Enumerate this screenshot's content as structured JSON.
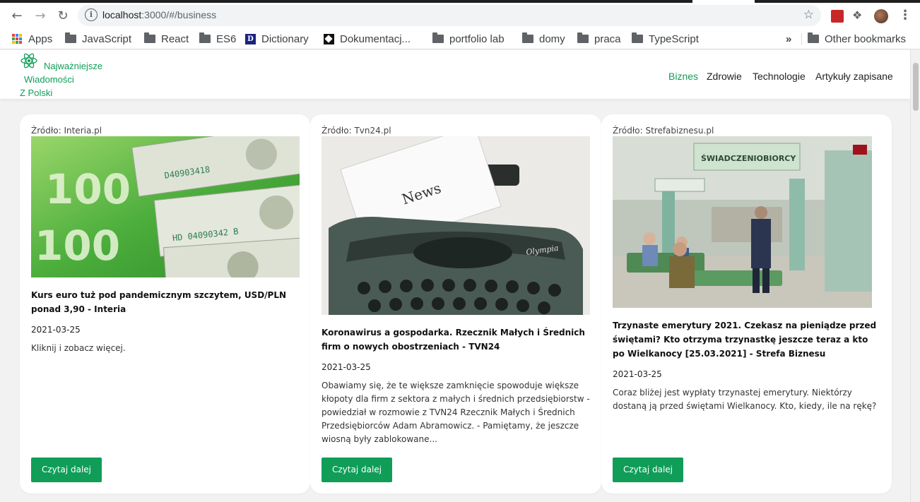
{
  "browser": {
    "url_host": "localhost",
    "url_rest": ":3000/#/business",
    "bookmarks": [
      {
        "label": "Apps",
        "icon": "apps-grid-icon"
      },
      {
        "label": "JavaScript",
        "icon": "folder-icon"
      },
      {
        "label": "React",
        "icon": "folder-icon"
      },
      {
        "label": "ES6",
        "icon": "folder-icon"
      },
      {
        "label": "Dictionary",
        "icon": "dictionary-icon"
      },
      {
        "label": "Dokumentacj...",
        "icon": "document-icon"
      },
      {
        "label": "portfolio lab",
        "icon": "folder-icon"
      },
      {
        "label": "domy",
        "icon": "folder-icon"
      },
      {
        "label": "praca",
        "icon": "folder-icon"
      },
      {
        "label": "TypeScript",
        "icon": "folder-icon"
      }
    ],
    "overflow_label": "»",
    "other_bookmarks": "Other bookmarks"
  },
  "site": {
    "brand_line1": "Najważniejsze",
    "brand_line2": "Wiadomości",
    "brand_line3": "Z Polski",
    "nav": [
      {
        "label": "Biznes",
        "active": true
      },
      {
        "label": "Zdrowie",
        "active": false
      },
      {
        "label": "Technologie",
        "active": false
      },
      {
        "label": "Artykuły zapisane",
        "active": false
      }
    ]
  },
  "articles": [
    {
      "source": "Źródło: Interia.pl",
      "title": "Kurs euro tuż pod pandemicznym szczytem, USD/PLN ponad 3,90 - Interia",
      "date": "2021-03-25",
      "description": "Kliknij i zobacz więcej.",
      "button": "Czytaj dalej",
      "image": "banknotes-photo"
    },
    {
      "source": "Źródło: Tvn24.pl",
      "title": "Koronawirus a gospodarka. Rzecznik Małych i Średnich firm o nowych obostrzeniach - TVN24",
      "date": "2021-03-25",
      "description": "Obawiamy się, że te większe zamknięcie spowoduje większe kłopoty dla firm z sektora z małych i średnich przedsiębiorstw - powiedział w rozmowie z TVN24 Rzecznik Małych i Średnich Przedsiębiorców Adam Abramowicz. - Pamiętamy, że jeszcze wiosną były zablokowane...",
      "button": "Czytaj dalej",
      "image": "typewriter-photo",
      "image_text": "News"
    },
    {
      "source": "Źródło: Strefabiznesu.pl",
      "title": "Trzynaste emerytury 2021. Czekasz na pieniądze przed świętami? Kto otrzyma trzynastkę jeszcze teraz a kto po Wielkanocy [25.03.2021] - Strefa Biznesu",
      "date": "2021-03-25",
      "description": "Coraz bliżej jest wypłaty trzynastej emerytury. Niektórzy dostaną ją przed świętami Wielkanocy. Kto, kiedy, ile na rękę?",
      "button": "Czytaj dalej",
      "image": "office-hall-photo",
      "image_text": "ŚWIADCZENIOBIORCY"
    }
  ],
  "colors": {
    "accent": "#0f9d58",
    "page_bg": "#f2f2f2"
  }
}
